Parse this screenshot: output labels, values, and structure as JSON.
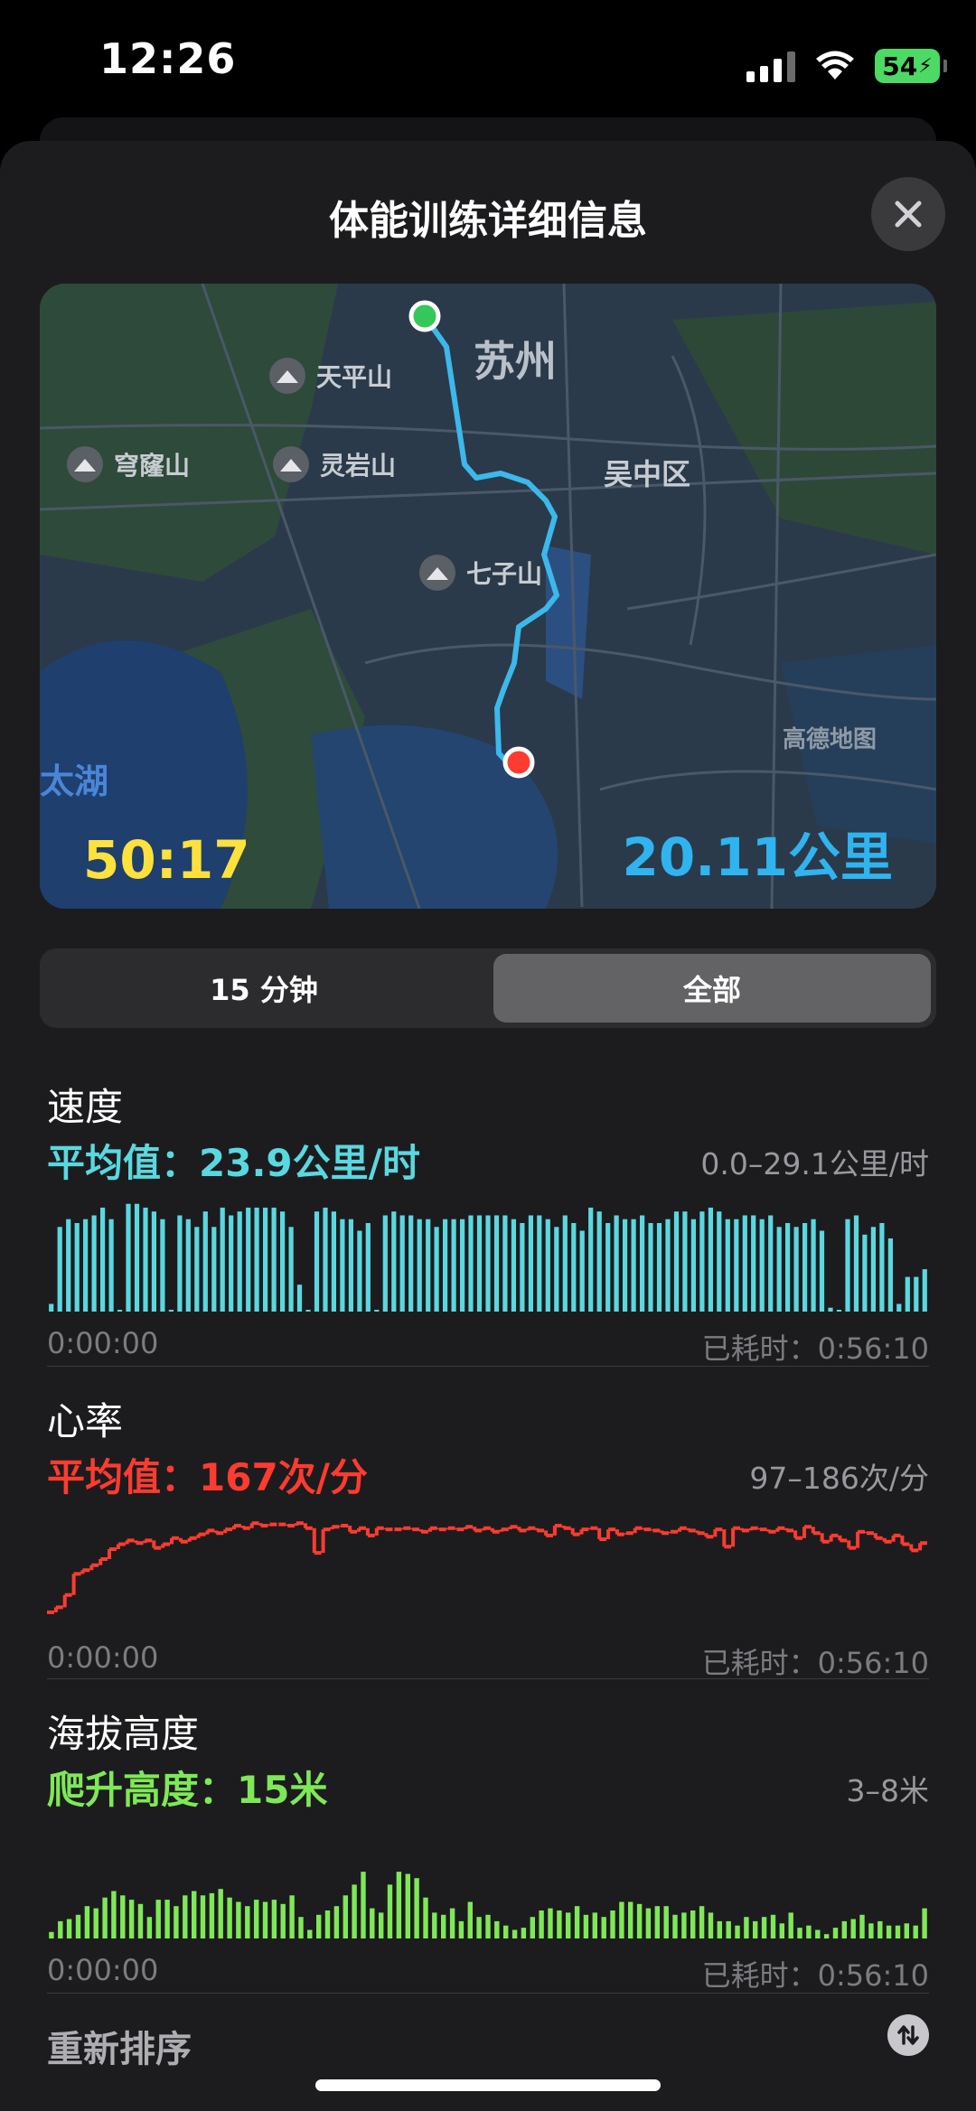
{
  "status_bar": {
    "time": "12:26",
    "battery": "54"
  },
  "sheet": {
    "title": "体能训练详细信息"
  },
  "map": {
    "labels": {
      "city": "苏州",
      "district": "吴中区",
      "lake": "太湖",
      "watermark": "高德地图"
    },
    "pois": [
      "天平山",
      "穹窿山",
      "灵岩山",
      "七子山"
    ],
    "duration": "50:17",
    "distance": "20.11公里"
  },
  "segmented": {
    "options": [
      "15 分钟",
      "全部"
    ],
    "selected": "全部"
  },
  "speed": {
    "title": "速度",
    "average": "平均值：23.9公里/时",
    "range": "0.0–29.1公里/时",
    "start": "0:00:00",
    "end": "已耗时：0:56:10",
    "color": "#5ad8e0",
    "chart_data": {
      "type": "bar",
      "series_name": "速度",
      "ylim": [
        0,
        29.1
      ],
      "values": [
        2,
        22,
        24,
        23,
        24,
        25,
        27,
        24,
        0,
        28,
        28,
        27,
        26,
        24,
        0,
        25,
        24,
        22,
        26,
        22,
        27,
        25,
        26,
        27,
        27,
        27,
        27,
        26,
        22,
        7,
        0,
        26,
        27,
        26,
        24,
        24,
        21,
        23,
        0,
        25,
        26,
        25,
        25,
        24,
        24,
        22,
        24,
        24,
        24,
        25,
        25,
        25,
        25,
        25,
        24,
        23,
        25,
        25,
        24,
        22,
        25,
        23,
        21,
        27,
        26,
        23,
        25,
        24,
        24,
        25,
        23,
        23,
        24,
        26,
        26,
        24,
        26,
        27,
        26,
        24,
        24,
        25,
        25,
        24,
        25,
        22,
        23,
        22,
        23,
        24,
        21,
        1,
        0,
        24,
        25,
        20,
        22,
        23,
        19,
        2,
        9,
        9,
        11
      ]
    }
  },
  "heart_rate": {
    "title": "心率",
    "average": "平均值：167次/分",
    "range": "97–186次/分",
    "start": "0:00:00",
    "end": "已耗时：0:56:10",
    "color": "#ff3b30",
    "chart_data": {
      "type": "line",
      "series_name": "心率",
      "ylim": [
        97,
        186
      ],
      "values": [
        108,
        112,
        122,
        139,
        142,
        146,
        151,
        159,
        163,
        166,
        164,
        166,
        160,
        163,
        168,
        165,
        168,
        171,
        174,
        172,
        175,
        178,
        176,
        180,
        178,
        179,
        179,
        178,
        180,
        176,
        156,
        175,
        177,
        178,
        173,
        176,
        170,
        176,
        175,
        175,
        176,
        175,
        173,
        176,
        175,
        176,
        175,
        177,
        174,
        176,
        173,
        175,
        177,
        174,
        176,
        174,
        170,
        178,
        176,
        171,
        175,
        176,
        167,
        175,
        171,
        172,
        176,
        175,
        174,
        172,
        173,
        176,
        174,
        172,
        169,
        175,
        161,
        176,
        174,
        176,
        175,
        173,
        176,
        174,
        168,
        177,
        172,
        165,
        170,
        166,
        160,
        173,
        172,
        168,
        165,
        170,
        163,
        158,
        164
      ]
    }
  },
  "elevation": {
    "title": "海拔高度",
    "climb": "爬升高度：15米",
    "range": "3–8米",
    "start": "0:00:00",
    "end": "已耗时：0:56:10",
    "color": "#7fe857",
    "chart_data": {
      "type": "bar",
      "series_name": "海拔高度",
      "ylim": [
        3,
        8
      ],
      "values": [
        3.1,
        3.6,
        3.7,
        3.9,
        4.3,
        4.2,
        4.7,
        5.0,
        4.8,
        4.6,
        4.4,
        3.8,
        4.6,
        4.6,
        4.3,
        4.8,
        5.0,
        4.8,
        4.9,
        5.1,
        4.7,
        4.5,
        4.3,
        4.6,
        4.5,
        4.6,
        4.4,
        4.8,
        3.8,
        3.2,
        3.9,
        4.1,
        4.3,
        4.8,
        5.3,
        5.9,
        4.2,
        4.0,
        5.3,
        5.9,
        5.8,
        5.6,
        4.7,
        4.0,
        3.9,
        4.2,
        3.6,
        4.5,
        3.8,
        3.9,
        3.6,
        3.4,
        3.2,
        3.3,
        3.8,
        4.1,
        4.2,
        4.1,
        4.0,
        4.3,
        3.9,
        4.0,
        3.8,
        4.1,
        4.5,
        4.5,
        4.4,
        4.2,
        4.3,
        4.3,
        3.9,
        4.0,
        4.1,
        4.3,
        4.0,
        3.6,
        3.6,
        3.4,
        3.8,
        3.6,
        3.8,
        3.9,
        3.5,
        4.0,
        3.3,
        3.4,
        3.2,
        3.0,
        3.3,
        3.6,
        3.7,
        3.9,
        3.5,
        3.6,
        3.4,
        3.4,
        3.5,
        3.4,
        4.2
      ]
    }
  },
  "footer": {
    "reorder": "重新排序"
  }
}
